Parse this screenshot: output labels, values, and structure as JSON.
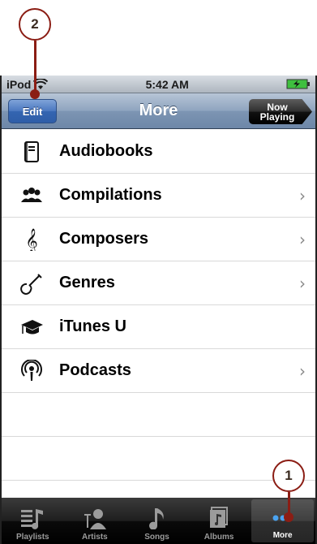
{
  "callouts": {
    "one": "1",
    "two": "2"
  },
  "status_bar": {
    "carrier": "iPod",
    "time": "5:42 AM"
  },
  "nav": {
    "title": "More",
    "edit_label": "Edit",
    "now_playing_line1": "Now",
    "now_playing_line2": "Playing"
  },
  "items": [
    {
      "label": "Audiobooks",
      "icon": "audiobook-icon",
      "chevron": false
    },
    {
      "label": "Compilations",
      "icon": "compilations-icon",
      "chevron": true
    },
    {
      "label": "Composers",
      "icon": "treble-clef-icon",
      "chevron": true
    },
    {
      "label": "Genres",
      "icon": "guitar-icon",
      "chevron": true
    },
    {
      "label": "iTunes U",
      "icon": "graduation-cap-icon",
      "chevron": false
    },
    {
      "label": "Podcasts",
      "icon": "podcast-icon",
      "chevron": true
    }
  ],
  "tabs": [
    {
      "label": "Playlists",
      "icon": "playlists-icon"
    },
    {
      "label": "Artists",
      "icon": "artists-icon"
    },
    {
      "label": "Songs",
      "icon": "music-note-icon"
    },
    {
      "label": "Albums",
      "icon": "albums-icon"
    },
    {
      "label": "More",
      "icon": "more-dots-icon",
      "active": true
    }
  ],
  "colors": {
    "callout": "#8b1d14",
    "nav_blue": "#6d87a8",
    "edit_blue": "#3465b1"
  }
}
